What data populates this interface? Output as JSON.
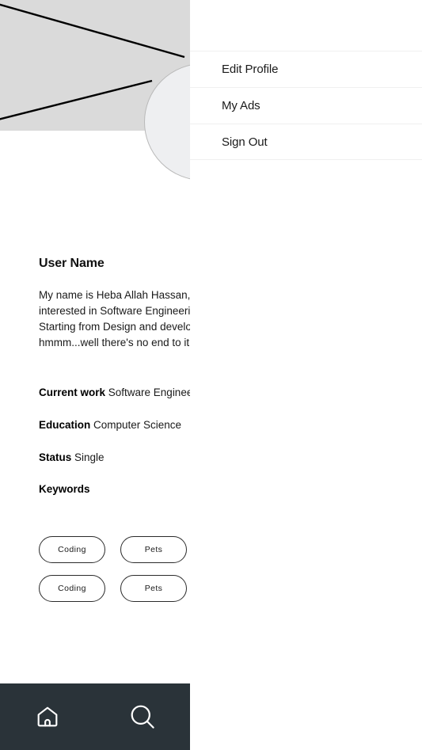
{
  "colors": {
    "cover_placeholder": "#dadada",
    "avatar_fill": "#eeeff1",
    "nav_bar": "#2a3339",
    "text_primary": "#1a1a1a",
    "chip_border": "#2b2b2b",
    "divider": "#f0f0f0",
    "page_background": "#ffffff"
  },
  "profile": {
    "cover_icon": "image-placeholder-icon",
    "avatar_icon": "avatar-placeholder",
    "user_name": "User Name",
    "bio": "My name is Heba Allah Hassan, I'm\ninterested in Software Engineering.\nStarting from Design and development,\nhmmm...well there's no end to it.",
    "details": [
      {
        "label": "Current work",
        "value": " Software Engineer"
      },
      {
        "label": "Education",
        "value": " Computer Science"
      },
      {
        "label": "Status",
        "value": " Single"
      }
    ],
    "keywords_heading": "Keywords",
    "keyword_rows": [
      [
        "Coding",
        "Pets"
      ],
      [
        "Coding",
        "Pets"
      ]
    ]
  },
  "menu": {
    "items": [
      {
        "label": "Edit Profile",
        "name": "menu-item-edit-profile"
      },
      {
        "label": "My Ads",
        "name": "menu-item-my-ads"
      },
      {
        "label": "Sign Out",
        "name": "menu-item-sign-out"
      }
    ]
  },
  "bottom_nav": {
    "items": [
      {
        "icon": "home-icon",
        "label": "Home"
      },
      {
        "icon": "search-icon",
        "label": "Search"
      }
    ]
  }
}
